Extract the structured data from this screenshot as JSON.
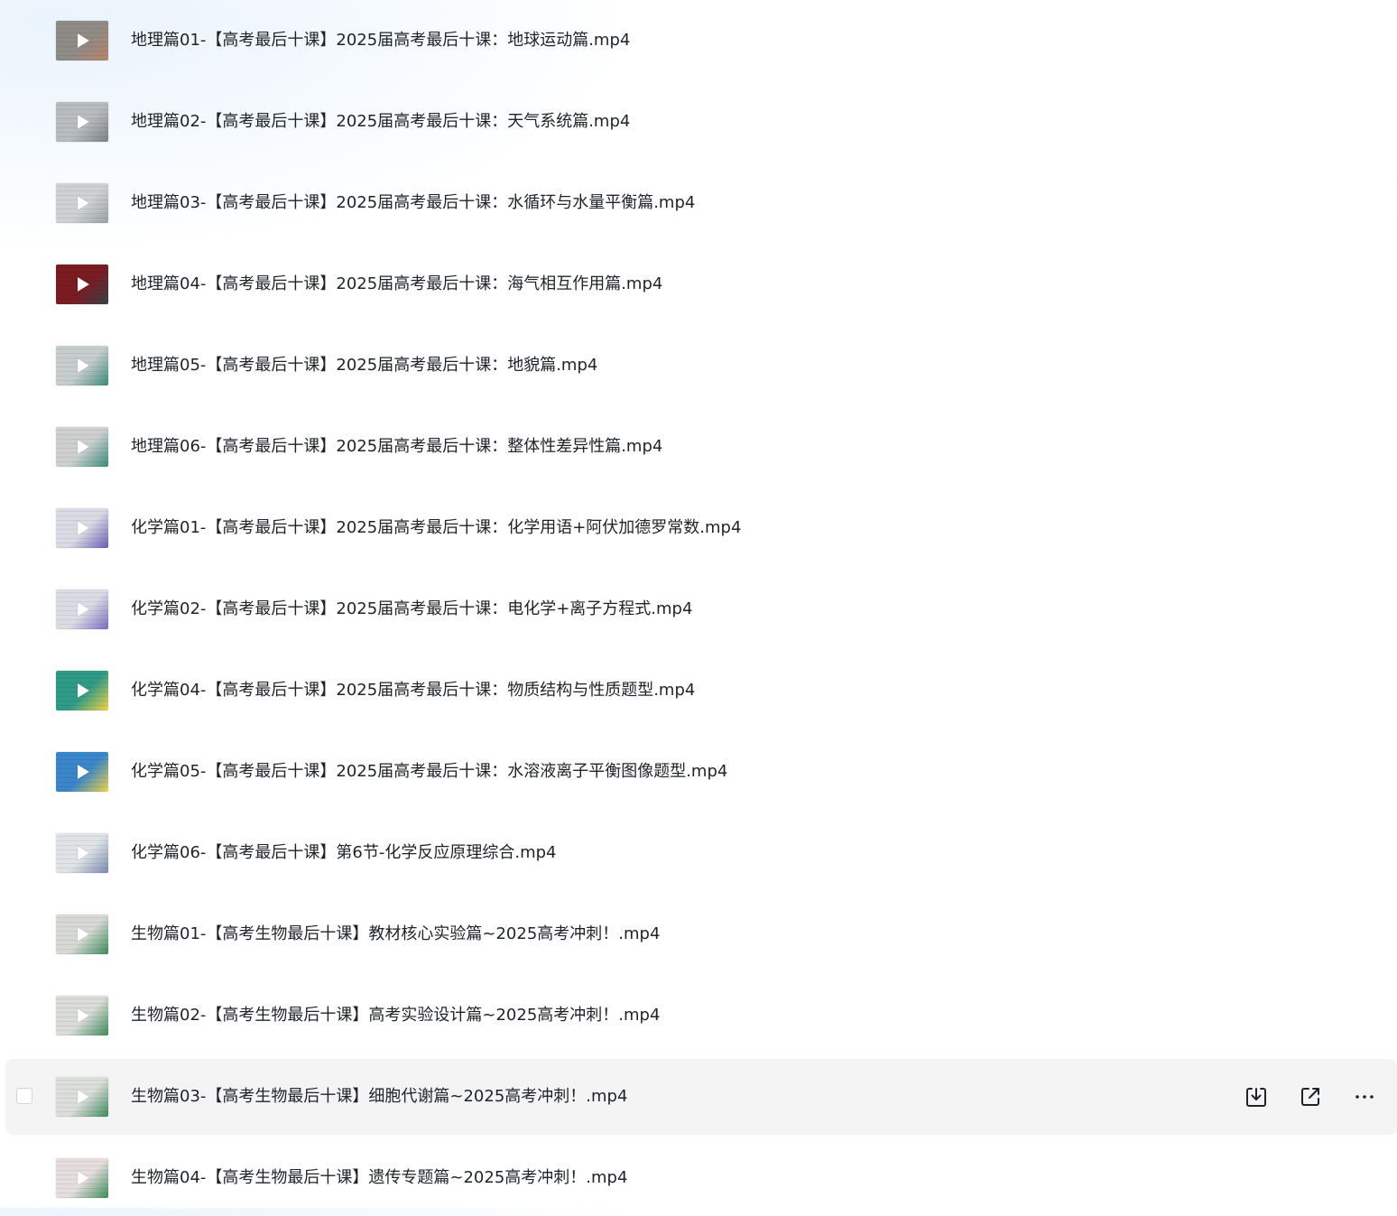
{
  "colors": {
    "hover_row_bg": "#f4f4f5",
    "text": "#1f2329",
    "icon": "#1f2329"
  },
  "files": [
    {
      "name": "地理篇01-【高考最后十课】2025届高考最后十课：地球运动篇.mp4",
      "thumb_color": "#8f8b86",
      "thumb_accent": "#b8846a"
    },
    {
      "name": "地理篇02-【高考最后十课】2025届高考最后十课：天气系统篇.mp4",
      "thumb_color": "#b9bcbf",
      "thumb_accent": "#7d8086"
    },
    {
      "name": "地理篇03-【高考最后十课】2025届高考最后十课：水循环与水量平衡篇.mp4",
      "thumb_color": "#cfd2d2",
      "thumb_accent": "#9aa1a3"
    },
    {
      "name": "地理篇04-【高考最后十课】2025届高考最后十课：海气相互作用篇.mp4",
      "thumb_color": "#7a1c22",
      "thumb_accent": "#3a3f48"
    },
    {
      "name": "地理篇05-【高考最后十课】2025届高考最后十课：地貌篇.mp4",
      "thumb_color": "#c7cccc",
      "thumb_accent": "#3c8a7a"
    },
    {
      "name": "地理篇06-【高考最后十课】2025届高考最后十课：整体性差异性篇.mp4",
      "thumb_color": "#cdd0cf",
      "thumb_accent": "#3c8a7a"
    },
    {
      "name": "化学篇01-【高考最后十课】2025届高考最后十课：化学用语+阿伏加德罗常数.mp4",
      "thumb_color": "#d8dbe4",
      "thumb_accent": "#6a5fb0"
    },
    {
      "name": "化学篇02-【高考最后十课】2025届高考最后十课：电化学+离子方程式.mp4",
      "thumb_color": "#d9dde3",
      "thumb_accent": "#7a6bc0"
    },
    {
      "name": "化学篇04-【高考最后十课】2025届高考最后十课：物质结构与性质题型.mp4",
      "thumb_color": "#2f9a86",
      "thumb_accent": "#f1d34a"
    },
    {
      "name": "化学篇05-【高考最后十课】2025届高考最后十课：水溶液离子平衡图像题型.mp4",
      "thumb_color": "#3a86c8",
      "thumb_accent": "#f1d34a"
    },
    {
      "name": "化学篇06-【高考最后十课】第6节-化学反应原理综合.mp4",
      "thumb_color": "#dfe3e6",
      "thumb_accent": "#7a8ab0"
    },
    {
      "name": "生物篇01-【高考生物最后十课】教材核心实验篇~2025高考冲刺！.mp4",
      "thumb_color": "#d7d9d5",
      "thumb_accent": "#3c8a5a"
    },
    {
      "name": "生物篇02-【高考生物最后十课】高考实验设计篇~2025高考冲刺！.mp4",
      "thumb_color": "#dadcd8",
      "thumb_accent": "#3c8a5a"
    },
    {
      "name": "生物篇03-【高考生物最后十课】细胞代谢篇~2025高考冲刺！.mp4",
      "thumb_color": "#dcdedb",
      "thumb_accent": "#3c8a5a",
      "hovered": true
    },
    {
      "name": "生物篇04-【高考生物最后十课】遗传专题篇~2025高考冲刺！.mp4",
      "thumb_color": "#e6dede",
      "thumb_accent": "#3c8a5a"
    }
  ],
  "icons": {
    "thumb_overlay": "play-icon",
    "download": "download-icon",
    "share": "share-icon",
    "more": "more-icon"
  }
}
